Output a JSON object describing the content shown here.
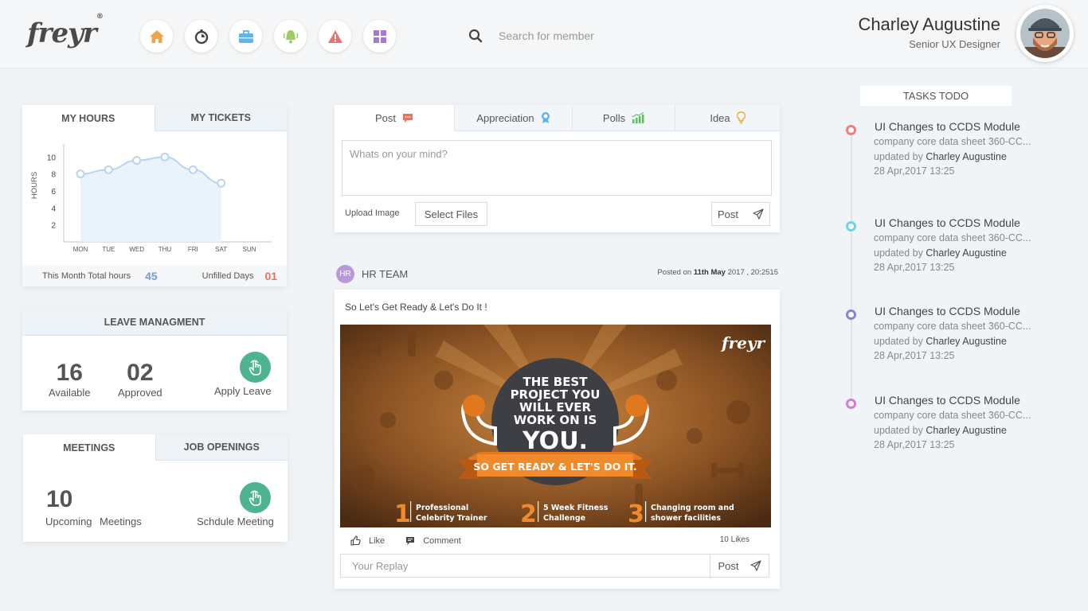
{
  "brand": {
    "logo_text": "freyr",
    "logo_mark": "®"
  },
  "nav": {
    "icons": [
      {
        "name": "home-icon",
        "color": "#f0a44a"
      },
      {
        "name": "timer-icon",
        "color": "#444444"
      },
      {
        "name": "briefcase-icon",
        "color": "#5bb6e6"
      },
      {
        "name": "notification-icon",
        "color": "#9ccc65"
      },
      {
        "name": "alert-icon",
        "color": "#e57373"
      },
      {
        "name": "apps-icon",
        "color": "#a57ad1"
      }
    ]
  },
  "search": {
    "placeholder": "Search for member"
  },
  "user": {
    "name": "Charley Augustine",
    "role": "Senior UX Designer"
  },
  "hours": {
    "tabs": [
      "MY HOURS",
      "MY TICKETS"
    ],
    "active_tab": "MY HOURS",
    "total_label": "This Month Total hours",
    "total_value": "45",
    "unfilled_label": "Unfilled Days",
    "unfilled_value": "01",
    "total_color": "#6a9fd8",
    "unfilled_color": "#e8735f"
  },
  "chart_data": {
    "type": "area",
    "categories": [
      "MON",
      "TUE",
      "WED",
      "THU",
      "FRI",
      "SAT",
      "SUN"
    ],
    "values": [
      8,
      8.5,
      9.6,
      10,
      8.5,
      6.9,
      null
    ],
    "ylabel": "HOURS",
    "yticks": [
      2,
      4,
      6,
      8,
      10
    ],
    "ylim": [
      0,
      12
    ],
    "grid": false,
    "color": "#b8d4ee"
  },
  "leave": {
    "title": "LEAVE MANAGMENT",
    "available_value": "16",
    "available_label": "Available",
    "approved_value": "02",
    "approved_label": "Approved",
    "apply_label": "Apply Leave"
  },
  "meetings": {
    "tabs": [
      "MEETINGS",
      "JOB OPENINGS"
    ],
    "active_tab": "MEETINGS",
    "count": "10",
    "upcoming_label": "Upcoming",
    "meetings_label": "Meetings",
    "schedule_label": "Schdule Meeting"
  },
  "composer": {
    "tabs": [
      {
        "label": "Post",
        "icon": "chat-icon",
        "color": "#e8735f"
      },
      {
        "label": "Appreciation",
        "icon": "award-icon",
        "color": "#5bb6e6"
      },
      {
        "label": "Polls",
        "icon": "poll-chart-icon",
        "color": "#66bb6a"
      },
      {
        "label": "Idea",
        "icon": "lightbulb-icon",
        "color": "#f0b429"
      }
    ],
    "placeholder": "Whats on your mind?",
    "upload_label": "Upload Image",
    "select_files": "Select Files",
    "post_label": "Post"
  },
  "feed": {
    "author_initials": "HR",
    "author": "HR TEAM",
    "posted_prefix": "Posted on ",
    "posted_date": "11th May",
    "posted_time": " 2017 , 20:2515",
    "text": "So Let's Get Ready & Let's Do It !",
    "banner": {
      "brand": "freyr",
      "headline_lines": [
        "THE BEST",
        "PROJECT YOU",
        "WILL EVER",
        "WORK ON IS"
      ],
      "headline_big": "YOU.",
      "ribbon": "SO GET READY & LET'S DO IT.",
      "features": [
        {
          "num": "1",
          "line1": "Professional",
          "line2": "Celebrity Trainer"
        },
        {
          "num": "2",
          "line1": "5 Week Fitness",
          "line2": "Challenge"
        },
        {
          "num": "3",
          "line1": "Changing room and",
          "line2": "shower facilities"
        }
      ]
    },
    "like_label": "Like",
    "comment_label": "Comment",
    "likes_count": "10 Likes",
    "reply_placeholder": "Your Replay",
    "reply_post": "Post"
  },
  "tasks": {
    "title": "TASKS TODO",
    "items": [
      {
        "title": "UI Changes to CCDS Module",
        "desc": "company core data sheet 360-CC...",
        "updated_prefix": "updated by ",
        "updated_by": "Charley Augustine",
        "date": "28 Apr,2017 13:25",
        "color": "#ef7d7d"
      },
      {
        "title": "UI Changes to CCDS Module",
        "desc": "company core data sheet 360-CC...",
        "updated_prefix": "updated by ",
        "updated_by": "Charley Augustine",
        "date": "28 Apr,2017 13:25",
        "color": "#6fd3e0"
      },
      {
        "title": "UI Changes to CCDS Module",
        "desc": "company core data sheet 360-CC...",
        "updated_prefix": "updated by ",
        "updated_by": "Charley Augustine",
        "date": "28 Apr,2017 13:25",
        "color": "#8a80d8"
      },
      {
        "title": "UI Changes to CCDS Module",
        "desc": "company core data sheet 360-CC...",
        "updated_prefix": "updated by ",
        "updated_by": "Charley Augustine",
        "date": "28 Apr,2017 13:25",
        "color": "#d47ad8"
      }
    ]
  }
}
